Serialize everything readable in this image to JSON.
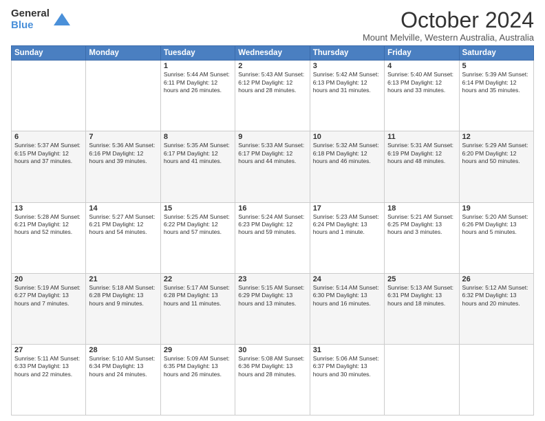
{
  "logo": {
    "general": "General",
    "blue": "Blue"
  },
  "title": "October 2024",
  "subtitle": "Mount Melville, Western Australia, Australia",
  "days_of_week": [
    "Sunday",
    "Monday",
    "Tuesday",
    "Wednesday",
    "Thursday",
    "Friday",
    "Saturday"
  ],
  "weeks": [
    [
      {
        "day": "",
        "info": ""
      },
      {
        "day": "",
        "info": ""
      },
      {
        "day": "1",
        "info": "Sunrise: 5:44 AM\nSunset: 6:11 PM\nDaylight: 12 hours and 26 minutes."
      },
      {
        "day": "2",
        "info": "Sunrise: 5:43 AM\nSunset: 6:12 PM\nDaylight: 12 hours and 28 minutes."
      },
      {
        "day": "3",
        "info": "Sunrise: 5:42 AM\nSunset: 6:13 PM\nDaylight: 12 hours and 31 minutes."
      },
      {
        "day": "4",
        "info": "Sunrise: 5:40 AM\nSunset: 6:13 PM\nDaylight: 12 hours and 33 minutes."
      },
      {
        "day": "5",
        "info": "Sunrise: 5:39 AM\nSunset: 6:14 PM\nDaylight: 12 hours and 35 minutes."
      }
    ],
    [
      {
        "day": "6",
        "info": "Sunrise: 5:37 AM\nSunset: 6:15 PM\nDaylight: 12 hours and 37 minutes."
      },
      {
        "day": "7",
        "info": "Sunrise: 5:36 AM\nSunset: 6:16 PM\nDaylight: 12 hours and 39 minutes."
      },
      {
        "day": "8",
        "info": "Sunrise: 5:35 AM\nSunset: 6:17 PM\nDaylight: 12 hours and 41 minutes."
      },
      {
        "day": "9",
        "info": "Sunrise: 5:33 AM\nSunset: 6:17 PM\nDaylight: 12 hours and 44 minutes."
      },
      {
        "day": "10",
        "info": "Sunrise: 5:32 AM\nSunset: 6:18 PM\nDaylight: 12 hours and 46 minutes."
      },
      {
        "day": "11",
        "info": "Sunrise: 5:31 AM\nSunset: 6:19 PM\nDaylight: 12 hours and 48 minutes."
      },
      {
        "day": "12",
        "info": "Sunrise: 5:29 AM\nSunset: 6:20 PM\nDaylight: 12 hours and 50 minutes."
      }
    ],
    [
      {
        "day": "13",
        "info": "Sunrise: 5:28 AM\nSunset: 6:21 PM\nDaylight: 12 hours and 52 minutes."
      },
      {
        "day": "14",
        "info": "Sunrise: 5:27 AM\nSunset: 6:21 PM\nDaylight: 12 hours and 54 minutes."
      },
      {
        "day": "15",
        "info": "Sunrise: 5:25 AM\nSunset: 6:22 PM\nDaylight: 12 hours and 57 minutes."
      },
      {
        "day": "16",
        "info": "Sunrise: 5:24 AM\nSunset: 6:23 PM\nDaylight: 12 hours and 59 minutes."
      },
      {
        "day": "17",
        "info": "Sunrise: 5:23 AM\nSunset: 6:24 PM\nDaylight: 13 hours and 1 minute."
      },
      {
        "day": "18",
        "info": "Sunrise: 5:21 AM\nSunset: 6:25 PM\nDaylight: 13 hours and 3 minutes."
      },
      {
        "day": "19",
        "info": "Sunrise: 5:20 AM\nSunset: 6:26 PM\nDaylight: 13 hours and 5 minutes."
      }
    ],
    [
      {
        "day": "20",
        "info": "Sunrise: 5:19 AM\nSunset: 6:27 PM\nDaylight: 13 hours and 7 minutes."
      },
      {
        "day": "21",
        "info": "Sunrise: 5:18 AM\nSunset: 6:28 PM\nDaylight: 13 hours and 9 minutes."
      },
      {
        "day": "22",
        "info": "Sunrise: 5:17 AM\nSunset: 6:28 PM\nDaylight: 13 hours and 11 minutes."
      },
      {
        "day": "23",
        "info": "Sunrise: 5:15 AM\nSunset: 6:29 PM\nDaylight: 13 hours and 13 minutes."
      },
      {
        "day": "24",
        "info": "Sunrise: 5:14 AM\nSunset: 6:30 PM\nDaylight: 13 hours and 16 minutes."
      },
      {
        "day": "25",
        "info": "Sunrise: 5:13 AM\nSunset: 6:31 PM\nDaylight: 13 hours and 18 minutes."
      },
      {
        "day": "26",
        "info": "Sunrise: 5:12 AM\nSunset: 6:32 PM\nDaylight: 13 hours and 20 minutes."
      }
    ],
    [
      {
        "day": "27",
        "info": "Sunrise: 5:11 AM\nSunset: 6:33 PM\nDaylight: 13 hours and 22 minutes."
      },
      {
        "day": "28",
        "info": "Sunrise: 5:10 AM\nSunset: 6:34 PM\nDaylight: 13 hours and 24 minutes."
      },
      {
        "day": "29",
        "info": "Sunrise: 5:09 AM\nSunset: 6:35 PM\nDaylight: 13 hours and 26 minutes."
      },
      {
        "day": "30",
        "info": "Sunrise: 5:08 AM\nSunset: 6:36 PM\nDaylight: 13 hours and 28 minutes."
      },
      {
        "day": "31",
        "info": "Sunrise: 5:06 AM\nSunset: 6:37 PM\nDaylight: 13 hours and 30 minutes."
      },
      {
        "day": "",
        "info": ""
      },
      {
        "day": "",
        "info": ""
      }
    ]
  ]
}
